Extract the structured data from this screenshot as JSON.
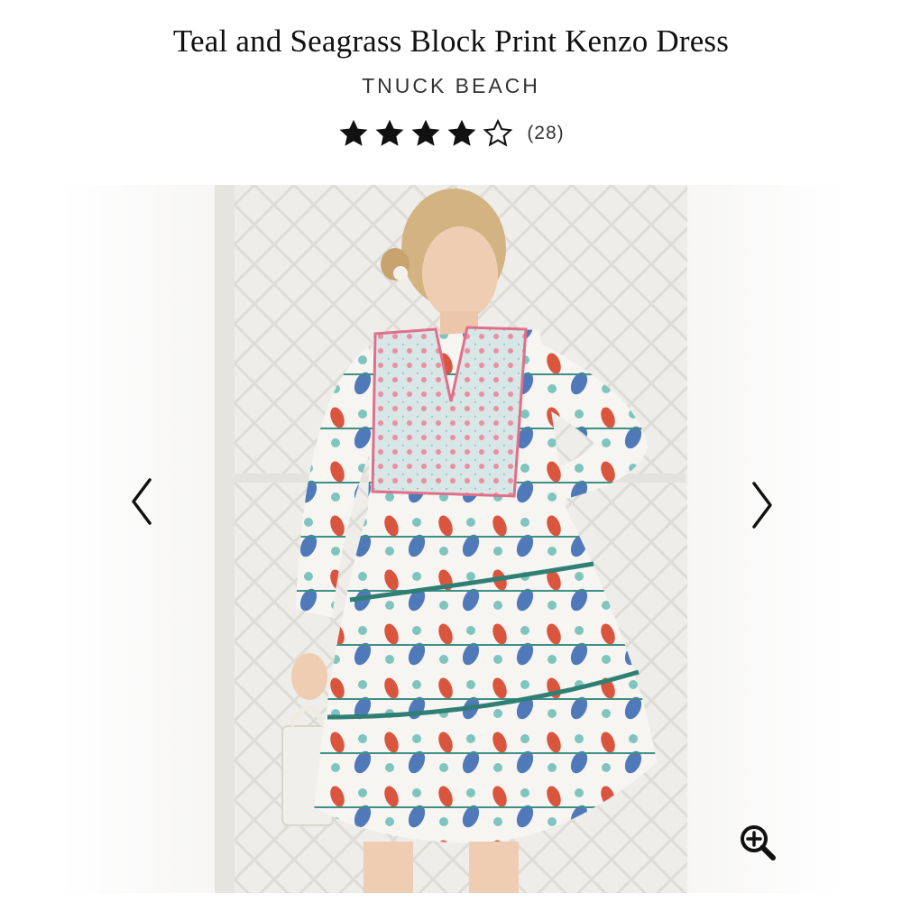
{
  "product": {
    "title": "Teal and Seagrass Block Print Kenzo Dress",
    "brand": "TNUCK BEACH",
    "rating": 4,
    "rating_max": 5,
    "review_count": "(28)"
  },
  "gallery": {
    "image_alt": "Model wearing teal and seagrass block print tiered dress",
    "prev_icon": "chevron-left-icon",
    "next_icon": "chevron-right-icon",
    "zoom_icon": "zoom-in-icon"
  },
  "colors": {
    "text": "#111111",
    "star": "#111111",
    "dress_teal": "#7fc4bd",
    "dress_red": "#d9553e",
    "dress_blue": "#4f79b8",
    "dress_pink": "#e98fa4"
  }
}
